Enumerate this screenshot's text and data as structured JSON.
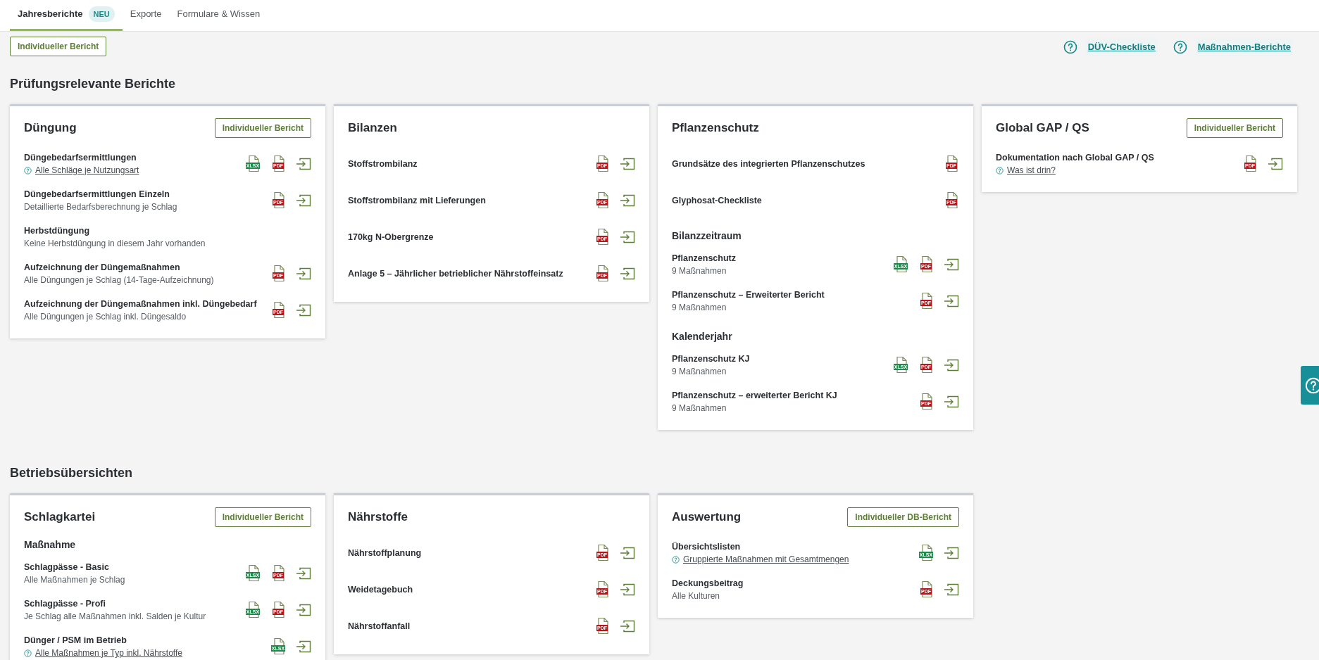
{
  "tabs": [
    {
      "label": "Jahresberichte",
      "badge": "NEU",
      "selected": true
    },
    {
      "label": "Exporte",
      "selected": false
    },
    {
      "label": "Formulare & Wissen",
      "selected": false
    }
  ],
  "toolbar": {
    "button": "Individueller Bericht",
    "help_links": [
      "DÜV-Checkliste",
      "Maßnahmen-Berichte"
    ]
  },
  "sections": [
    {
      "title": "Prüfungsrelevante Berichte",
      "cards": [
        {
          "title": "Düngung",
          "button": "Individueller Bericht",
          "blocks": [
            {
              "kind": "item",
              "title": "Düngebedarfsermittlungen",
              "link": "Alle Schläge je Nutzungsart",
              "formats": [
                {
                  "kind": "xlsx",
                  "label": "XLSX"
                },
                {
                  "kind": "pdf",
                  "label": "PDF"
                }
              ],
              "export": true
            },
            {
              "kind": "item",
              "title": "Düngebedarfsermittlungen Einzeln",
              "subtitle": "Detaillierte Bedarfsberechnung je Schlag",
              "formats": [
                {
                  "kind": "pdf",
                  "label": "PDF"
                }
              ],
              "export": true
            },
            {
              "kind": "item",
              "title": "Herbstdüngung",
              "subtitle": "Keine Herbstdüngung in diesem Jahr vorhanden",
              "export": false
            },
            {
              "kind": "item",
              "title": "Aufzeichnung der Düngemaßnahmen",
              "subtitle": "Alle Düngungen je Schlag (14-Tage-Aufzeichnung)",
              "formats": [
                {
                  "kind": "pdf",
                  "label": "PDF"
                }
              ],
              "export": true
            },
            {
              "kind": "item",
              "title": "Aufzeichnung der Düngemaßnahmen inkl. Düngebedarf",
              "subtitle": "Alle Düngungen je Schlag inkl. Düngesaldo",
              "formats": [
                {
                  "kind": "pdf",
                  "label": "PDF"
                }
              ],
              "export": true
            }
          ]
        },
        {
          "title": "Bilanzen",
          "blocks": [
            {
              "kind": "item",
              "title": "Stoffstrombilanz",
              "formats": [
                {
                  "kind": "pdf",
                  "label": "PDF"
                }
              ],
              "export": true
            },
            {
              "kind": "item",
              "title": "Stoffstrombilanz mit Lieferungen",
              "formats": [
                {
                  "kind": "pdf",
                  "label": "PDF"
                }
              ],
              "export": true
            },
            {
              "kind": "item",
              "title": "170kg N-Obergrenze",
              "formats": [
                {
                  "kind": "pdf",
                  "label": "PDF"
                }
              ],
              "export": true
            },
            {
              "kind": "item",
              "title": "Anlage 5 – Jährlicher betrieblicher Nährstoffeinsatz",
              "formats": [
                {
                  "kind": "pdf",
                  "label": "PDF"
                }
              ],
              "export": true
            }
          ]
        },
        {
          "title": "Pflanzenschutz",
          "blocks": [
            {
              "kind": "item",
              "title": "Grundsätze des integrierten Pflanzenschutzes",
              "formats": [
                {
                  "kind": "pdf",
                  "label": "PDF"
                }
              ],
              "export": false
            },
            {
              "kind": "item",
              "title": "Glyphosat-Checkliste",
              "formats": [
                {
                  "kind": "pdf",
                  "label": "PDF"
                }
              ],
              "export": false
            },
            {
              "kind": "heading",
              "text": "Bilanzzeitraum"
            },
            {
              "kind": "item",
              "title": "Pflanzenschutz",
              "subtitle": "9 Maßnahmen",
              "formats": [
                {
                  "kind": "xlsx",
                  "label": "XLSX"
                },
                {
                  "kind": "pdf",
                  "label": "PDF"
                }
              ],
              "export": true
            },
            {
              "kind": "item",
              "title": "Pflanzenschutz – Erweiterter Bericht",
              "subtitle": "9 Maßnahmen",
              "formats": [
                {
                  "kind": "pdf",
                  "label": "PDF"
                }
              ],
              "export": true
            },
            {
              "kind": "heading",
              "text": "Kalenderjahr"
            },
            {
              "kind": "item",
              "title": "Pflanzenschutz KJ",
              "subtitle": "9 Maßnahmen",
              "formats": [
                {
                  "kind": "xlsx",
                  "label": "XLSX"
                },
                {
                  "kind": "pdf",
                  "label": "PDF"
                }
              ],
              "export": true
            },
            {
              "kind": "item",
              "title": "Pflanzenschutz – erweiterter Bericht KJ",
              "subtitle": "9 Maßnahmen",
              "formats": [
                {
                  "kind": "pdf",
                  "label": "PDF"
                }
              ],
              "export": true
            }
          ]
        },
        {
          "title": "Global GAP / QS",
          "button": "Individueller Bericht",
          "blocks": [
            {
              "kind": "item",
              "title": "Dokumentation nach Global GAP / QS",
              "link": "Was ist drin?",
              "formats": [
                {
                  "kind": "pdf",
                  "label": "PDF"
                }
              ],
              "export": true
            }
          ]
        }
      ]
    },
    {
      "title": "Betriebsübersichten",
      "cards": [
        {
          "title": "Schlagkartei",
          "button": "Individueller Bericht",
          "blocks": [
            {
              "kind": "heading",
              "text": "Maßnahme"
            },
            {
              "kind": "item",
              "title": "Schlagpässe - Basic",
              "subtitle": "Alle Maßnahmen je Schlag",
              "formats": [
                {
                  "kind": "xlsx",
                  "label": "XLSX"
                },
                {
                  "kind": "pdf",
                  "label": "PDF"
                }
              ],
              "export": true
            },
            {
              "kind": "item",
              "title": "Schlagpässe - Profi",
              "subtitle": "Je Schlag alle Maßnahmen inkl. Salden je Kultur",
              "formats": [
                {
                  "kind": "xlsx",
                  "label": "XLSX"
                },
                {
                  "kind": "pdf",
                  "label": "PDF"
                }
              ],
              "export": true
            },
            {
              "kind": "item",
              "title": "Dünger / PSM im Betrieb",
              "link": "Alle Maßnahmen je Typ inkl. Nährstoffe",
              "formats": [
                {
                  "kind": "xlsx",
                  "label": "XLSX"
                }
              ],
              "export": true
            }
          ]
        },
        {
          "title": "Nährstoffe",
          "blocks": [
            {
              "kind": "item",
              "title": "Nährstoffplanung",
              "formats": [
                {
                  "kind": "pdf",
                  "label": "PDF"
                }
              ],
              "export": true
            },
            {
              "kind": "item",
              "title": "Weidetagebuch",
              "formats": [
                {
                  "kind": "pdf",
                  "label": "PDF"
                }
              ],
              "export": true
            },
            {
              "kind": "item",
              "title": "Nährstoffanfall",
              "formats": [
                {
                  "kind": "pdf",
                  "label": "PDF"
                }
              ],
              "export": true
            }
          ]
        },
        {
          "title": "Auswertung",
          "button": "Individueller DB-Bericht",
          "blocks": [
            {
              "kind": "item",
              "title": "Übersichtslisten",
              "link": "Gruppierte Maßnahmen mit Gesamtmengen",
              "formats": [
                {
                  "kind": "xlsx",
                  "label": "XLSX"
                }
              ],
              "export": true
            },
            {
              "kind": "item",
              "title": "Deckungsbeitrag",
              "subtitle": "Alle Kulturen",
              "formats": [
                {
                  "kind": "pdf",
                  "label": "PDF"
                }
              ],
              "export": true
            }
          ]
        }
      ]
    }
  ]
}
